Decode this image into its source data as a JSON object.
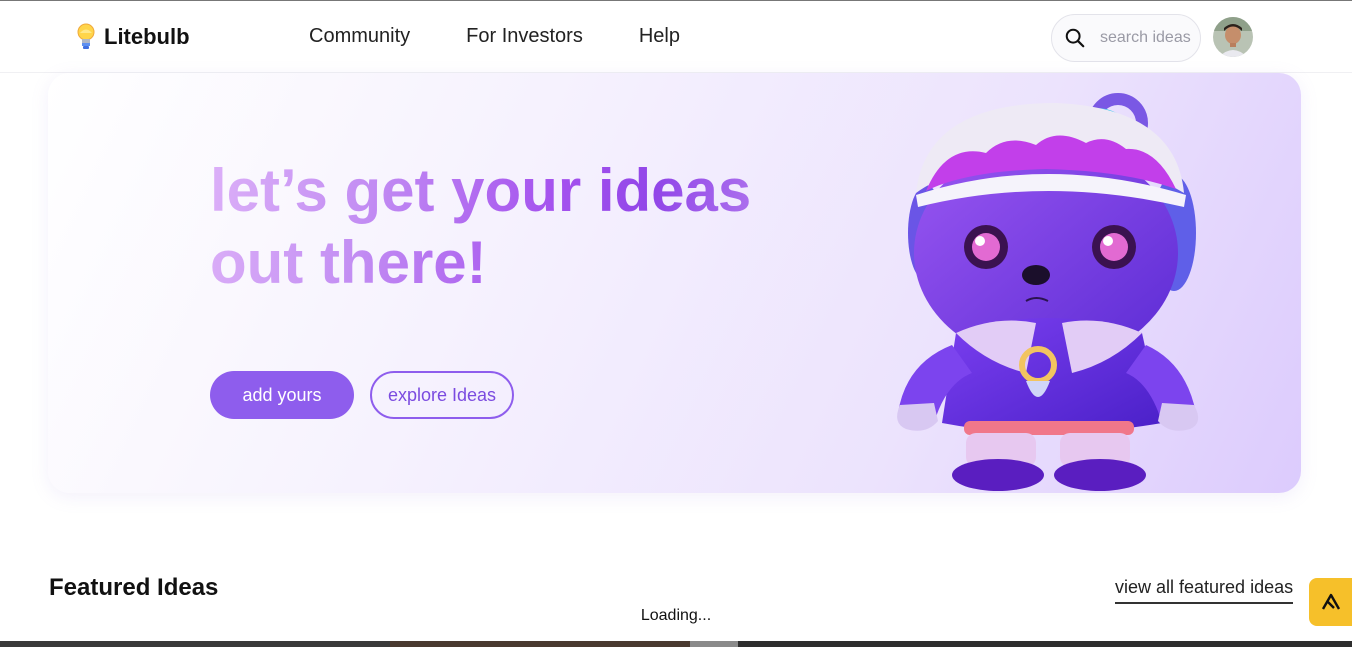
{
  "brand": {
    "name": "Litebulb",
    "logo_icon": "lightbulb-icon"
  },
  "nav": {
    "items": [
      {
        "label": "Community"
      },
      {
        "label": "For Investors"
      },
      {
        "label": "Help"
      }
    ]
  },
  "search": {
    "placeholder": "search ideas",
    "value": "",
    "icon": "search-icon"
  },
  "hero": {
    "title_line1": "let’s get your ideas",
    "title_line2": "out there!",
    "primary_button": "add yours",
    "secondary_button": "explore Ideas",
    "mascot": "bear-mascot-illustration"
  },
  "featured": {
    "title": "Featured Ideas",
    "view_all": "view all featured ideas",
    "loading_text": "Loading..."
  },
  "colors": {
    "accent": "#8e5ded",
    "accent_dark": "#9146e8",
    "badge": "#f6c02a"
  }
}
